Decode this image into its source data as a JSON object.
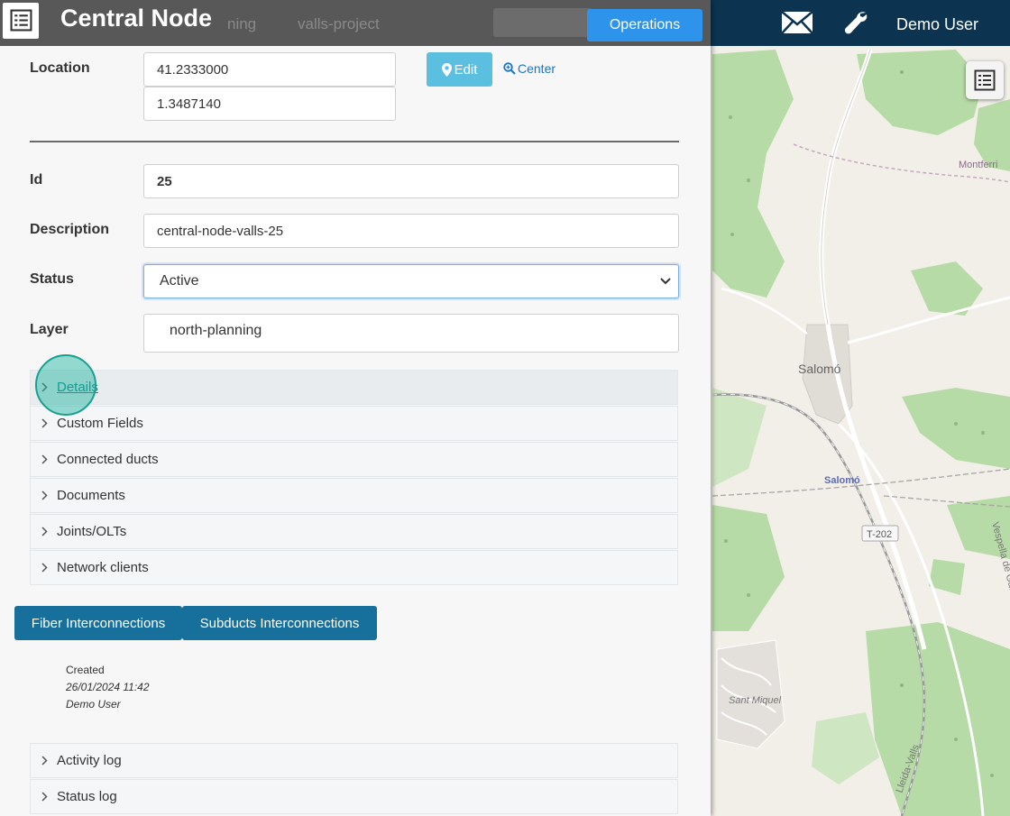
{
  "panel": {
    "title": "Central Node",
    "background_ghost": {
      "tab1": "ning",
      "tab2": "valls-project"
    },
    "operations_label": "Operations",
    "location": {
      "label": "Location",
      "lat": "41.2333000",
      "lng": "1.3487140",
      "edit_label": "Edit",
      "center_label": "Center"
    },
    "id": {
      "label": "Id",
      "value": "25"
    },
    "description": {
      "label": "Description",
      "value": "central-node-valls-25"
    },
    "status": {
      "label": "Status",
      "value": "Active"
    },
    "layer": {
      "label": "Layer",
      "value": "north-planning"
    },
    "accordion": [
      {
        "label": "Details"
      },
      {
        "label": "Custom Fields"
      },
      {
        "label": "Connected ducts"
      },
      {
        "label": "Documents"
      },
      {
        "label": "Joints/OLTs"
      },
      {
        "label": "Network clients"
      }
    ],
    "buttons": {
      "fiber": "Fiber Interconnections",
      "subducts": "Subducts Interconnections"
    },
    "created": {
      "label": "Created",
      "date": "26/01/2024 11:42",
      "by": "Demo User"
    },
    "logs": [
      {
        "label": "Activity log"
      },
      {
        "label": "Status log"
      }
    ]
  },
  "topbar": {
    "user": "Demo User"
  },
  "map": {
    "places": {
      "salomo": "Salomó",
      "station": "Salomó",
      "montferri": "Montferri",
      "sant_miquel": "Sant Miquel",
      "road": "T-202",
      "vespella": "Vespella de Gaià",
      "lleida": "Lleida-Valls"
    }
  },
  "colors": {
    "header_bg": "#585858",
    "topbar_bg": "#0c3350",
    "operations": "#2e93ea",
    "edit": "#5bbfe0",
    "primary_btn": "#176f9c",
    "map_green": "#b6dba6",
    "map_land": "#f2efe9"
  }
}
